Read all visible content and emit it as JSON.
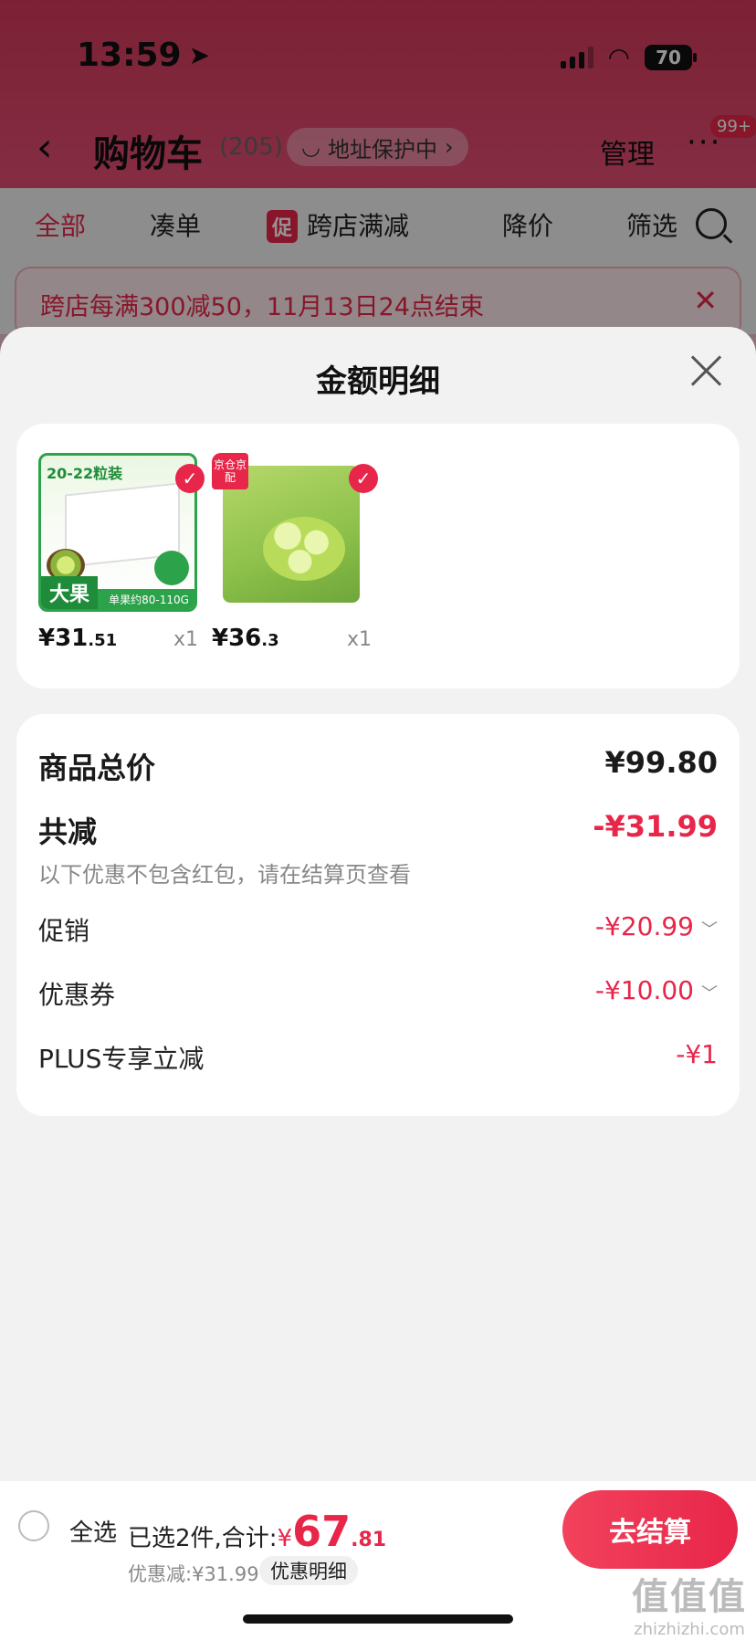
{
  "status_bar": {
    "time": "13:59",
    "battery": "70"
  },
  "header": {
    "title": "购物车",
    "count": "(205)",
    "address_chip": "地址保护中",
    "manage": "管理",
    "more_badge": "99+"
  },
  "tabs": [
    {
      "label": "全部"
    },
    {
      "label": "凑单"
    },
    {
      "promo_tag": "促",
      "label": "跨店满减"
    },
    {
      "label": "降价"
    },
    {
      "label": "筛选"
    }
  ],
  "promo_banner": {
    "text": "跨店每满300减50，11月13日24点结束"
  },
  "sheet": {
    "title": "金额明细",
    "products": [
      {
        "top_text": "20-22粒装",
        "badge_big": "大果",
        "badge_sub": "单果约80-110G",
        "price_main": "¥31",
        "price_dec": ".51",
        "qty": "x1"
      },
      {
        "tag": "京仓京配",
        "price_main": "¥36",
        "price_dec": ".3",
        "qty": "x1"
      }
    ],
    "details": {
      "total_label": "商品总价",
      "total_value": "¥99.80",
      "reduce_label": "共减",
      "reduce_value": "-¥31.99",
      "note": "以下优惠不包含红包，请在结算页查看",
      "items": [
        {
          "label": "促销",
          "value": "-¥20.99",
          "has_chevron": true
        },
        {
          "label": "优惠券",
          "value": "-¥10.00",
          "has_chevron": true
        },
        {
          "label": "PLUS专享立减",
          "value": "-¥1",
          "has_chevron": false
        }
      ]
    }
  },
  "bottom_bar": {
    "select_all": "全选",
    "selected_text": "已选2件,合计:",
    "currency": "¥",
    "total_int": "67",
    "total_dec": ".81",
    "discount_text": "优惠减:¥31.99",
    "detail_chip": "优惠明细",
    "checkout": "去结算"
  },
  "watermark": {
    "logo": "值值值",
    "url": "zhizhizhi.com"
  },
  "colors": {
    "accent": "#e8264a",
    "header_bg": "#d63a5c"
  }
}
